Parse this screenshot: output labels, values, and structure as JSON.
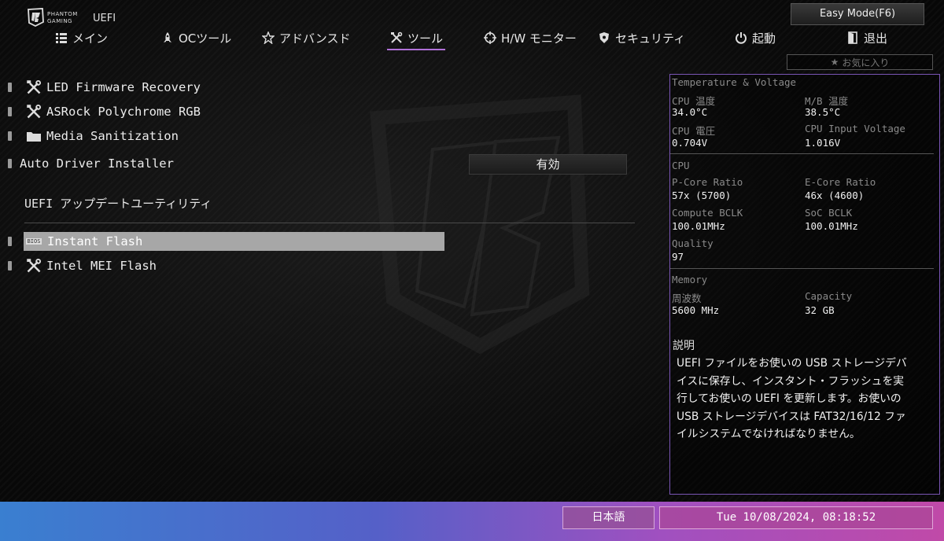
{
  "header": {
    "brand_line1": "PHANTOM",
    "brand_line2": "GAMING",
    "uefi_label": "UEFI",
    "easy_mode": "Easy Mode(F6)",
    "favorite": "お気に入り"
  },
  "nav": [
    {
      "label": "メイン",
      "icon": "list-icon"
    },
    {
      "label": "OCツール",
      "icon": "rocket-icon"
    },
    {
      "label": "アドバンスド",
      "icon": "star-icon"
    },
    {
      "label": "ツール",
      "icon": "tools-icon"
    },
    {
      "label": "H/W モニター",
      "icon": "crosshair-icon"
    },
    {
      "label": "セキュリティ",
      "icon": "shield-icon"
    },
    {
      "label": "起動",
      "icon": "power-icon"
    },
    {
      "label": "退出",
      "icon": "exit-door-icon"
    }
  ],
  "menu": {
    "items": [
      {
        "label": "LED Firmware Recovery",
        "icon": "tools-icon"
      },
      {
        "label": "ASRock Polychrome RGB",
        "icon": "tools-icon"
      },
      {
        "label": "Media Sanitization",
        "icon": "folder-icon"
      },
      {
        "label": "Auto Driver Installer",
        "value": "有効"
      }
    ],
    "section_title": "UEFI アップデートユーティリティ",
    "section_items": [
      {
        "label": "Instant Flash",
        "icon_text": "BIOS",
        "selected": true
      },
      {
        "label": "Intel MEI Flash",
        "icon": "tools-icon"
      }
    ]
  },
  "monitor": {
    "tv_heading": "Temperature & Voltage",
    "cpu_temp_label": "CPU 温度",
    "cpu_temp": "34.0°C",
    "mb_temp_label": "M/B 温度",
    "mb_temp": "38.5°C",
    "cpu_voltage_label": "CPU 電圧",
    "cpu_voltage": "0.704V",
    "cpu_input_voltage_label": "CPU Input Voltage",
    "cpu_input_voltage": "1.016V",
    "cpu_heading": "CPU",
    "pcore_label": "P-Core Ratio",
    "pcore": "57x (5700)",
    "ecore_label": "E-Core Ratio",
    "ecore": "46x (4600)",
    "compute_bclk_label": "Compute BCLK",
    "compute_bclk": "100.01MHz",
    "soc_bclk_label": "SoC BCLK",
    "soc_bclk": "100.01MHz",
    "quality_label": "Quality",
    "quality": "97",
    "memory_heading": "Memory",
    "freq_label": "周波数",
    "freq": "5600 MHz",
    "capacity_label": "Capacity",
    "capacity": "32 GB"
  },
  "description": {
    "heading": "説明",
    "text": "UEFI ファイルをお使いの USB ストレージデバイスに保存し、インスタント・フラッシュを実行してお使いの UEFI を更新します。お使いの USB ストレージデバイスは FAT32/16/12 ファイルシステムでなければなりません。"
  },
  "footer": {
    "language": "日本語",
    "datetime": "Tue 10/08/2024, 08:18:52"
  },
  "colors": {
    "accent": "#b070d8",
    "selected_row": "#a7a7a7",
    "panel_border": "#7a55b5"
  }
}
